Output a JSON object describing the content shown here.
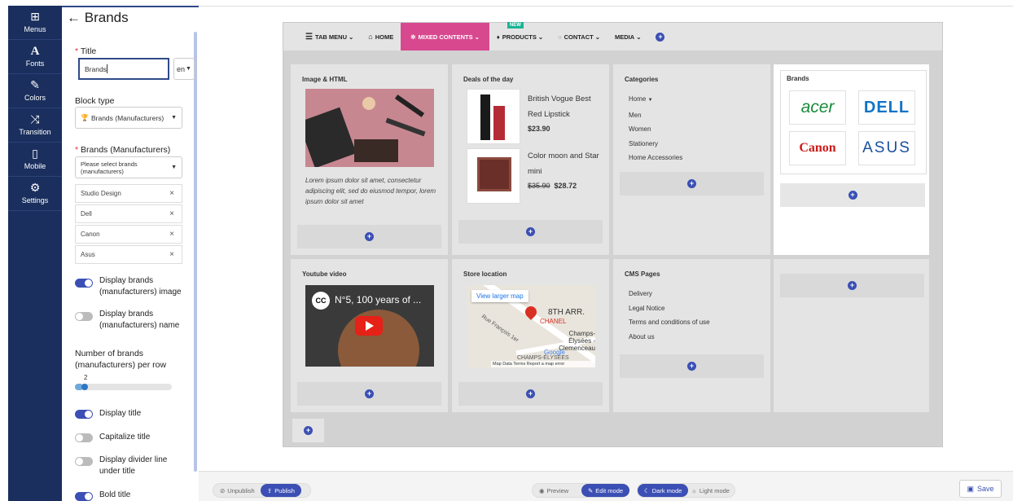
{
  "iconbar": [
    {
      "icon": "menus-icon",
      "glyph": "⊞",
      "label": "Menus"
    },
    {
      "icon": "fonts-icon",
      "glyph": "A",
      "label": "Fonts"
    },
    {
      "icon": "brush-icon",
      "glyph": "✎",
      "label": "Colors"
    },
    {
      "icon": "shuffle-icon",
      "glyph": "⤨",
      "label": "Transition"
    },
    {
      "icon": "mobile-icon",
      "glyph": "▯",
      "label": "Mobile"
    },
    {
      "icon": "gear-icon",
      "glyph": "⚙",
      "label": "Settings"
    }
  ],
  "panel": {
    "back_arrow": "←",
    "title": "Brands",
    "req": "*",
    "title_label": "Title",
    "title_value": "Brands",
    "lang": "en",
    "block_type_label": "Block type",
    "block_type_value": "Brands (Manufacturers)",
    "brands_label": "Brands (Manufacturers)",
    "brands_placeholder": "Please select brands (manufacturers)",
    "brands_selected": [
      "Studio Design",
      "Dell",
      "Canon",
      "Asus"
    ],
    "remove_symbol": "×",
    "opt_display_image": "Display brands (manufacturers) image",
    "opt_display_name": "Display brands (manufacturers) name",
    "per_row_label": "Number of brands (manufacturers) per row",
    "per_row_value": "2",
    "opt_display_title": "Display title",
    "opt_capitalize": "Capitalize title",
    "opt_divider": "Display divider line under title",
    "opt_bold": "Bold title"
  },
  "menu": {
    "tab_menu": "TAB MENU",
    "home": "HOME",
    "mixed": "MIXED CONTENTS",
    "products": "PRODUCTS",
    "new_badge": "NEW",
    "contact": "CONTACT",
    "media": "MEDIA"
  },
  "blocks": {
    "image_html": {
      "title": "Image & HTML",
      "text": "Lorem ipsum dolor sit amet, consectetur adipiscing elit, sed do eiusmod tempor, lorem ipsum dolor sit amet"
    },
    "deals": {
      "title": "Deals of the day",
      "p1_name": "British Vogue Best Red Lipstick",
      "p1_price": "$23.90",
      "p2_name": "Color moon and Star mini",
      "p2_old": "$35.90",
      "p2_price": "$28.72"
    },
    "categories": {
      "title": "Categories",
      "items": [
        "Home",
        "Men",
        "Women",
        "Stationery",
        "Home Accessories"
      ]
    },
    "brands": {
      "title": "Brands",
      "logos": [
        "acer",
        "DELL",
        "Canon",
        "ASUS"
      ]
    },
    "youtube": {
      "title": "Youtube video",
      "video_title": "N°5, 100 years of ..."
    },
    "store": {
      "title": "Store location",
      "map_button": "View larger map",
      "place1": "8TH ARR.",
      "place2": "CHANEL",
      "place3": "Champs-Élysées - Clemenceau",
      "place4": "CHAMPS-ÉLYSÉES",
      "street": "Rue François 1er",
      "attrib": "Map Data  Terms  Report a map error",
      "google": "Google"
    },
    "cms": {
      "title": "CMS Pages",
      "items": [
        "Delivery",
        "Legal Notice",
        "Terms and conditions of use",
        "About us"
      ]
    }
  },
  "bottom": {
    "unpublish": "Unpublish",
    "publish": "Publish",
    "preview": "Preview",
    "edit_mode": "Edit mode",
    "dark_mode": "Dark mode",
    "light_mode": "Light mode",
    "save": "Save"
  },
  "colors": {
    "navy": "#1a2f5e",
    "accent": "#3b4fb4",
    "magenta": "#d8488f"
  }
}
